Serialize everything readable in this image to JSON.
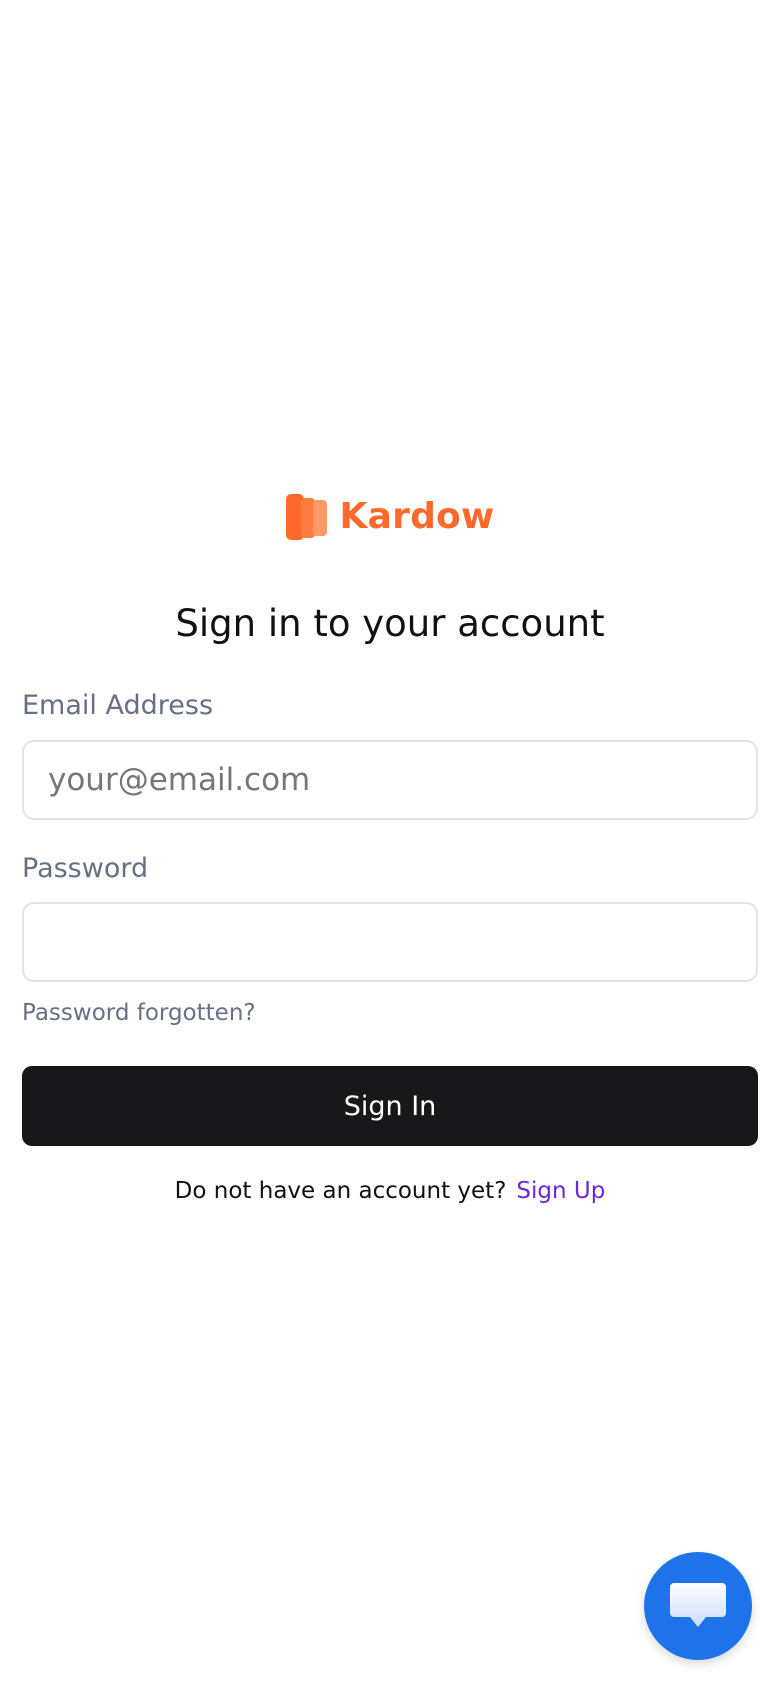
{
  "brand": {
    "name": "Kardow",
    "color": "#ff6a2b",
    "logo_icon": "book-columns-icon"
  },
  "page": {
    "title": "Sign in to your account"
  },
  "form": {
    "email": {
      "label": "Email Address",
      "placeholder": "your@email.com",
      "value": ""
    },
    "password": {
      "label": "Password",
      "placeholder": "",
      "value": ""
    },
    "forgot_link": "Password forgotten?",
    "submit_label": "Sign In"
  },
  "signup": {
    "prompt": "Do not have an account yet?",
    "link": "Sign Up",
    "link_color": "#6d28d9"
  },
  "chat": {
    "icon": "chat-bubble-icon",
    "color": "#1f73ea"
  }
}
